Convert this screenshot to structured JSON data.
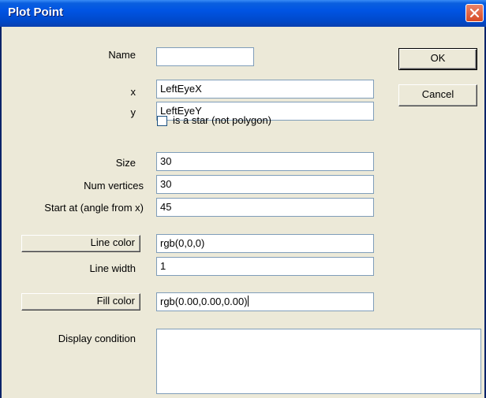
{
  "window": {
    "title": "Plot Point"
  },
  "labels": {
    "name": "Name",
    "x": "x",
    "y": "y",
    "is_star": "is a star (not polygon)",
    "size": "Size",
    "num_vertices": "Num vertices",
    "start_at": "Start at (angle from x)",
    "line_width": "Line width",
    "display_condition": "Display condition"
  },
  "fields": {
    "name": "",
    "x": "LeftEyeX",
    "y": "LeftEyeY",
    "size": "30",
    "num_vertices": "30",
    "start_at": "45",
    "line_color": "rgb(0,0,0)",
    "line_width": "1",
    "fill_color": "rgb(0.00,0.00,0.00)",
    "display_condition": ""
  },
  "checkbox": {
    "is_star_checked": false
  },
  "buttons": {
    "ok": "OK",
    "cancel": "Cancel",
    "line_color": "Line color",
    "fill_color": "Fill color"
  },
  "icons": {
    "close": "close-icon"
  },
  "colors": {
    "titlebar": "#0054e3",
    "close": "#d84b25",
    "dialog_bg": "#ece9d8"
  }
}
